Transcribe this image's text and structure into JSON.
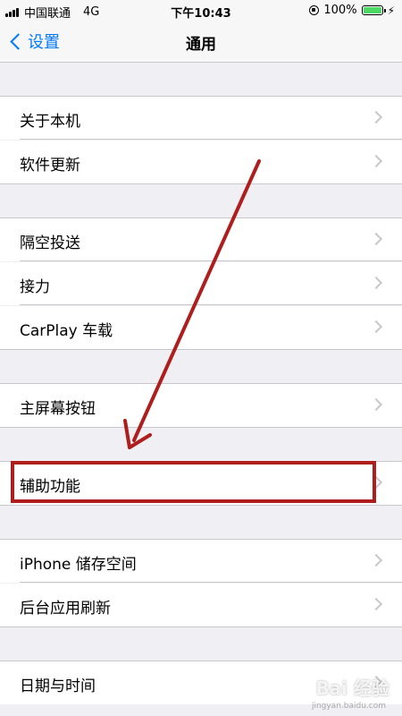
{
  "status_bar": {
    "carrier": "中国联通",
    "network": "4G",
    "time": "下午10:43",
    "battery": "100%",
    "battery_level": 1.0
  },
  "nav": {
    "back_label": "设置",
    "title": "通用"
  },
  "rows": [
    {
      "label": "关于本机"
    },
    {
      "label": "软件更新"
    },
    {
      "label": "隔空投送"
    },
    {
      "label": "接力"
    },
    {
      "label": "CarPlay 车载"
    },
    {
      "label": "主屏幕按钮"
    },
    {
      "label": "辅助功能"
    },
    {
      "label": "iPhone 储存空间"
    },
    {
      "label": "后台应用刷新"
    },
    {
      "label": "日期与时间"
    }
  ],
  "watermark": {
    "text": "Bai 经验",
    "sub": "jingyan.baidu.com"
  },
  "colors": {
    "accent": "#007aff",
    "annotation": "#b01d1d",
    "battery": "#4cd964"
  }
}
